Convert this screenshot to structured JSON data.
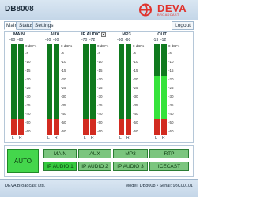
{
  "app": {
    "title": "DB8008"
  },
  "logo": {
    "name": "DEVA",
    "tagline": "BROADCAST"
  },
  "tabs": [
    {
      "label": "Main",
      "active": true
    },
    {
      "label": "Status",
      "active": false
    },
    {
      "label": "Settings",
      "active": false
    }
  ],
  "logout_label": "Logout",
  "meter_scale": [
    "0 dBFs",
    "-5",
    "-10",
    "-15",
    "-20",
    "-25",
    "-30",
    "-35",
    "-40",
    "-50",
    "-60"
  ],
  "meters": [
    {
      "name": "MAIN",
      "left_value": "-60",
      "right_value": "-60",
      "left_label": "L",
      "right_label": "R",
      "left_level": 0,
      "right_level": 0
    },
    {
      "name": "AUX",
      "left_value": "-60",
      "right_value": "-60",
      "left_label": "L",
      "right_label": "R",
      "left_level": 0,
      "right_level": 0
    },
    {
      "name": "IP AUDIO 1",
      "left_value": "-70",
      "right_value": "-72",
      "left_label": "L",
      "right_label": "R",
      "left_level": 0,
      "right_level": 0,
      "has_menu": true
    },
    {
      "name": "MP3",
      "left_value": "-60",
      "right_value": "-60",
      "left_label": "L",
      "right_label": "R",
      "left_level": 0,
      "right_level": 0
    },
    {
      "name": "OUT",
      "left_value": "-13",
      "right_value": "-12",
      "left_label": "L",
      "right_label": "R",
      "left_level": 0.64,
      "right_level": 0.65
    }
  ],
  "mode_button": {
    "label": "AUTO"
  },
  "sources": [
    {
      "label": "MAIN",
      "state": "dim"
    },
    {
      "label": "AUX",
      "state": "dim"
    },
    {
      "label": "MP3",
      "state": "dim"
    },
    {
      "label": "RTP",
      "state": "dim"
    },
    {
      "label": "IP AUDIO 1",
      "state": "lit"
    },
    {
      "label": "IP AUDIO 2",
      "state": "dim"
    },
    {
      "label": "IP AUDIO 3",
      "state": "dim"
    },
    {
      "label": "ICECAST",
      "state": "dim"
    }
  ],
  "footer": {
    "left": "DEVA Broadcast Ltd.",
    "right": "Model: DB8008 • Serial: 98C00101"
  },
  "colors": {
    "meter_dark": "#0f7a1e",
    "meter_lit": "#35e33b",
    "meter_red": "#d22b20",
    "accent": "#e0322c"
  }
}
